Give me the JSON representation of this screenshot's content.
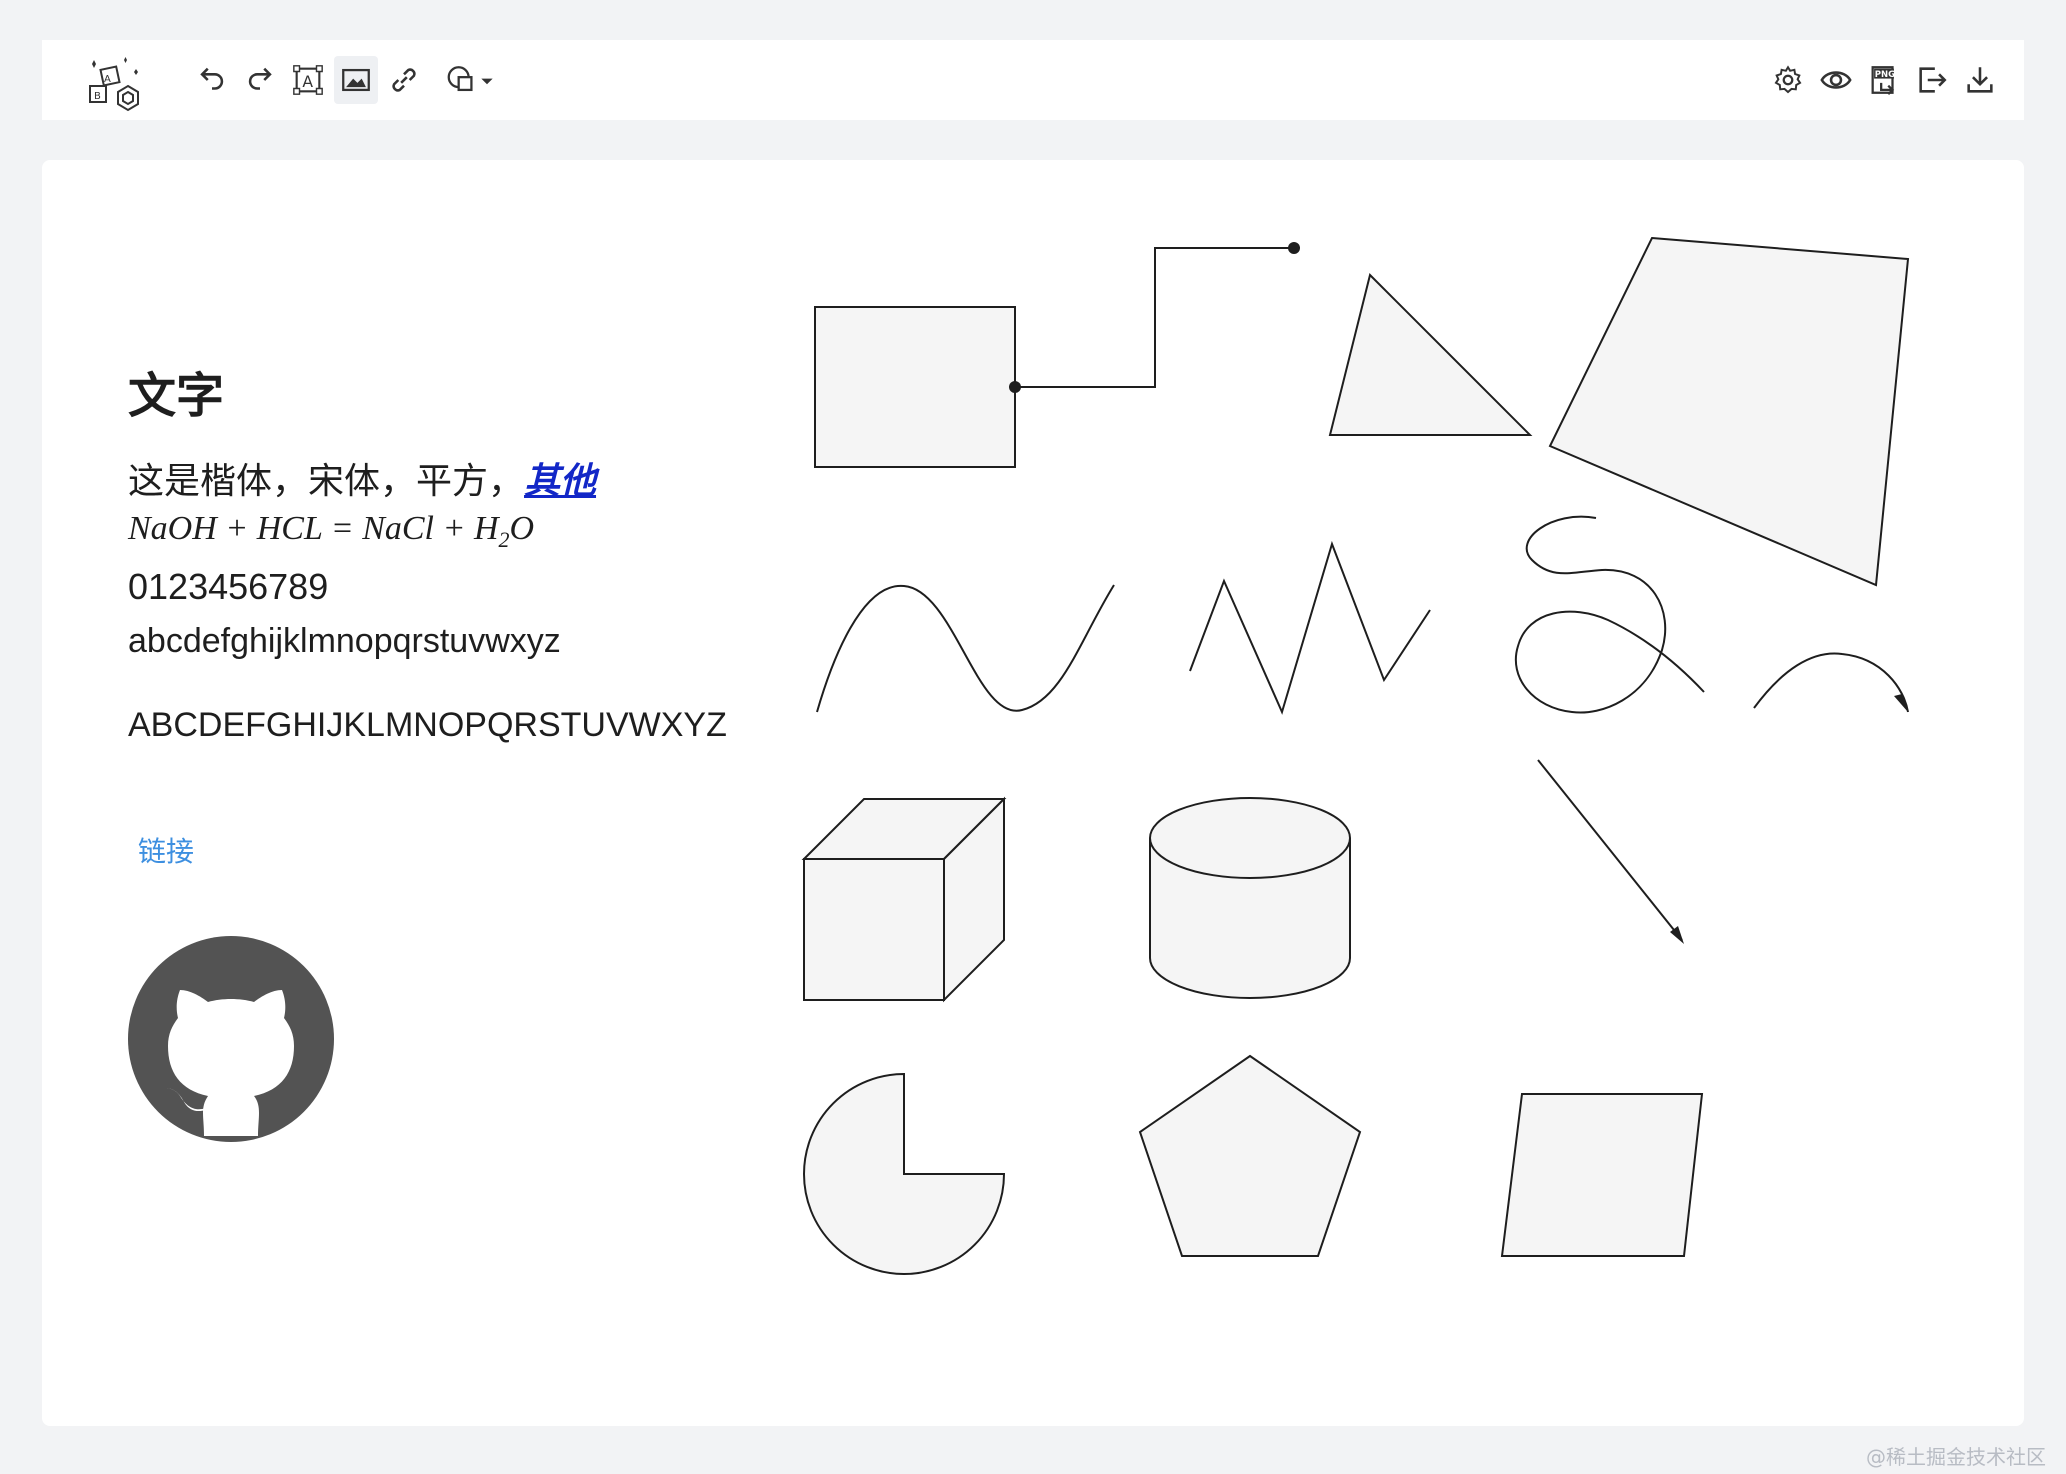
{
  "toolbar": {
    "left_icons": [
      "undo-icon",
      "redo-icon",
      "text-icon",
      "image-icon",
      "link-icon",
      "shapes-icon"
    ],
    "right_icons": [
      "settings-icon",
      "preview-icon",
      "export-png-icon",
      "export-icon",
      "download-icon"
    ],
    "png_label": "PNG"
  },
  "content": {
    "heading": "文字",
    "fonts_line_prefix": "这是楷体，宋体，平方，",
    "fonts_line_other": "其他",
    "formula_before": "NaOH + HCL = NaCl + H",
    "formula_sub": "2",
    "formula_after": "O",
    "digits": "0123456789",
    "lowercase": "abcdefghijklmnopqrstuvwxyz",
    "uppercase": "ABCDEFGHIJKLMNOPQRSTUVWXYZ",
    "link_label": "链接"
  },
  "colors": {
    "shape_fill": "#f5f5f5",
    "stroke": "#1e1e1e",
    "link": "#3d8fe0",
    "other_text": "#1227c7",
    "github": "#535353"
  },
  "watermark": "@稀土掘金技术社区"
}
